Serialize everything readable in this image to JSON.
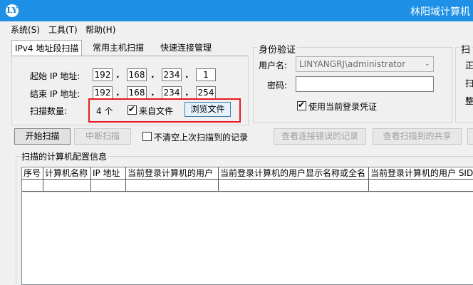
{
  "window": {
    "title": "林阳域计算机",
    "icon_letters": "LY"
  },
  "menu": [
    "系统(S)",
    "工具(T)",
    "帮助(H)"
  ],
  "tabs": [
    "IPv4 地址段扫描",
    "常用主机扫描",
    "快速连接管理"
  ],
  "ip_range": {
    "start_label": "起始 IP 地址:",
    "end_label": "结束 IP 地址:",
    "start": [
      "192",
      "168",
      "234",
      "1"
    ],
    "end": [
      "192",
      "168",
      "234",
      "254"
    ]
  },
  "scan_count": {
    "label": "扫描数量:",
    "value": "4 个",
    "from_file_label": "来自文件",
    "from_file_checked": true,
    "browse_label": "浏览文件"
  },
  "auth": {
    "group_title": "身份验证",
    "username_label": "用户名:",
    "username_value": "LINYANGRJ\\administrator",
    "password_label": "密码:",
    "password_value": "",
    "use_current_label": "使用当前登录凭证",
    "use_current_checked": true
  },
  "right_group": {
    "title": "扫",
    "items": [
      "正",
      "扫",
      "整"
    ]
  },
  "actions": {
    "start_scan": "开始扫描",
    "stop_scan": "中断扫描",
    "keep_results_label": "不清空上次扫描到的记录",
    "keep_results_checked": false,
    "view_errors": "查看连接错误的记录",
    "view_shares": "查看扫描到的共享"
  },
  "results": {
    "title": "扫描的计算机配置信息",
    "columns": [
      "序号",
      "计算机名称",
      "IP 地址",
      "当前登录计算机的用户",
      "当前登录计算机的用户显示名称或全名",
      "当前登录计算机的用户 SID"
    ],
    "rows": []
  },
  "colors": {
    "titlebar": "#1e90e6",
    "highlight": "#e8191e"
  }
}
